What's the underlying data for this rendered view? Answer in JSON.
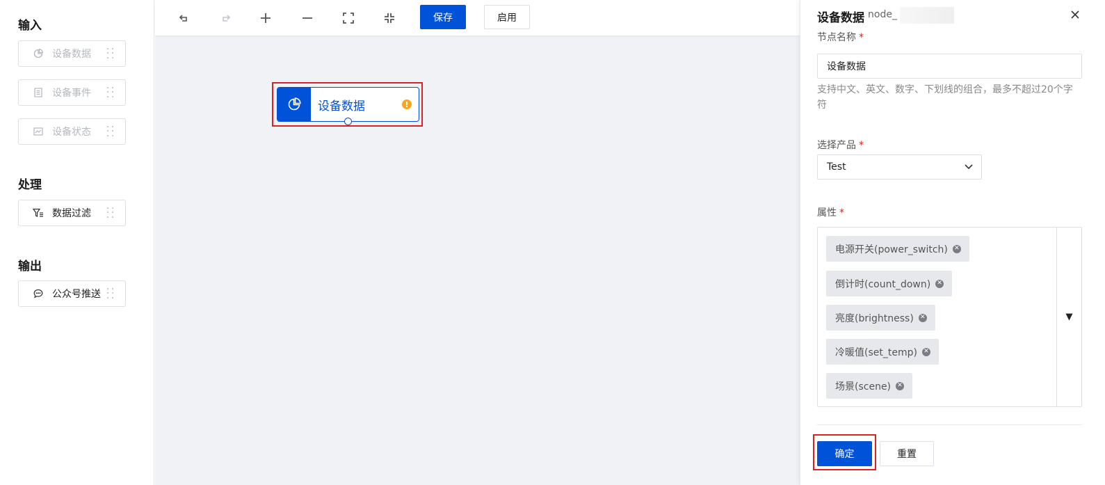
{
  "palette": {
    "sections": [
      {
        "title": "输入",
        "items": [
          {
            "label": "设备数据",
            "icon": "pie-chart-icon",
            "disabled": true
          },
          {
            "label": "设备事件",
            "icon": "document-icon",
            "disabled": true
          },
          {
            "label": "设备状态",
            "icon": "line-chart-icon",
            "disabled": true
          }
        ]
      },
      {
        "title": "处理",
        "items": [
          {
            "label": "数据过滤",
            "icon": "filter-icon",
            "disabled": false
          }
        ]
      },
      {
        "title": "输出",
        "items": [
          {
            "label": "公众号推送",
            "icon": "chat-icon",
            "disabled": false
          }
        ]
      }
    ]
  },
  "toolbar": {
    "undo_icon": "undo-icon",
    "redo_icon": "redo-icon",
    "zoom_in_icon": "plus-icon",
    "zoom_out_icon": "minus-icon",
    "fit_icon": "expand-icon",
    "shrink_icon": "collapse-icon",
    "save_label": "保存",
    "enable_label": "启用"
  },
  "canvas": {
    "node": {
      "label": "设备数据",
      "icon": "pie-chart-icon",
      "status": "warning",
      "warning_symbol": "!"
    }
  },
  "panel": {
    "title": "设备数据",
    "subtitle": "node_",
    "fields": {
      "name_label": "节点名称",
      "name_value": "设备数据",
      "name_hint": "支持中文、英文、数字、下划线的组合，最多不超过20个字符",
      "product_label": "选择产品",
      "product_value": "Test",
      "attr_label": "属性",
      "attributes": [
        "电源开关(power_switch)",
        "倒计时(count_down)",
        "亮度(brightness)",
        "冷暖值(set_temp)",
        "场景(scene)"
      ],
      "required_mark": "*"
    },
    "confirm_label": "确定",
    "reset_label": "重置"
  },
  "colors": {
    "primary": "#0052d9",
    "warning": "#f5a623",
    "highlight": "#e02020"
  }
}
